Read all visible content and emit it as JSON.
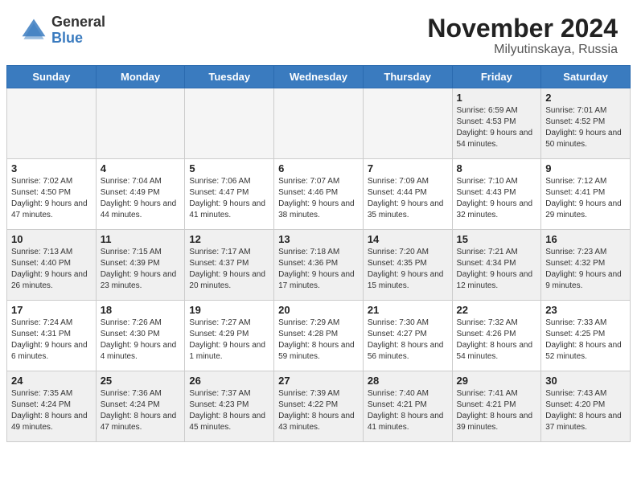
{
  "header": {
    "logo_general": "General",
    "logo_blue": "Blue",
    "title": "November 2024",
    "location": "Milyutinskaya, Russia"
  },
  "days_of_week": [
    "Sunday",
    "Monday",
    "Tuesday",
    "Wednesday",
    "Thursday",
    "Friday",
    "Saturday"
  ],
  "weeks": [
    [
      {
        "day": "",
        "empty": true
      },
      {
        "day": "",
        "empty": true
      },
      {
        "day": "",
        "empty": true
      },
      {
        "day": "",
        "empty": true
      },
      {
        "day": "",
        "empty": true
      },
      {
        "day": "1",
        "sunrise": "Sunrise: 6:59 AM",
        "sunset": "Sunset: 4:53 PM",
        "daylight": "Daylight: 9 hours and 54 minutes."
      },
      {
        "day": "2",
        "sunrise": "Sunrise: 7:01 AM",
        "sunset": "Sunset: 4:52 PM",
        "daylight": "Daylight: 9 hours and 50 minutes."
      }
    ],
    [
      {
        "day": "3",
        "sunrise": "Sunrise: 7:02 AM",
        "sunset": "Sunset: 4:50 PM",
        "daylight": "Daylight: 9 hours and 47 minutes."
      },
      {
        "day": "4",
        "sunrise": "Sunrise: 7:04 AM",
        "sunset": "Sunset: 4:49 PM",
        "daylight": "Daylight: 9 hours and 44 minutes."
      },
      {
        "day": "5",
        "sunrise": "Sunrise: 7:06 AM",
        "sunset": "Sunset: 4:47 PM",
        "daylight": "Daylight: 9 hours and 41 minutes."
      },
      {
        "day": "6",
        "sunrise": "Sunrise: 7:07 AM",
        "sunset": "Sunset: 4:46 PM",
        "daylight": "Daylight: 9 hours and 38 minutes."
      },
      {
        "day": "7",
        "sunrise": "Sunrise: 7:09 AM",
        "sunset": "Sunset: 4:44 PM",
        "daylight": "Daylight: 9 hours and 35 minutes."
      },
      {
        "day": "8",
        "sunrise": "Sunrise: 7:10 AM",
        "sunset": "Sunset: 4:43 PM",
        "daylight": "Daylight: 9 hours and 32 minutes."
      },
      {
        "day": "9",
        "sunrise": "Sunrise: 7:12 AM",
        "sunset": "Sunset: 4:41 PM",
        "daylight": "Daylight: 9 hours and 29 minutes."
      }
    ],
    [
      {
        "day": "10",
        "sunrise": "Sunrise: 7:13 AM",
        "sunset": "Sunset: 4:40 PM",
        "daylight": "Daylight: 9 hours and 26 minutes."
      },
      {
        "day": "11",
        "sunrise": "Sunrise: 7:15 AM",
        "sunset": "Sunset: 4:39 PM",
        "daylight": "Daylight: 9 hours and 23 minutes."
      },
      {
        "day": "12",
        "sunrise": "Sunrise: 7:17 AM",
        "sunset": "Sunset: 4:37 PM",
        "daylight": "Daylight: 9 hours and 20 minutes."
      },
      {
        "day": "13",
        "sunrise": "Sunrise: 7:18 AM",
        "sunset": "Sunset: 4:36 PM",
        "daylight": "Daylight: 9 hours and 17 minutes."
      },
      {
        "day": "14",
        "sunrise": "Sunrise: 7:20 AM",
        "sunset": "Sunset: 4:35 PM",
        "daylight": "Daylight: 9 hours and 15 minutes."
      },
      {
        "day": "15",
        "sunrise": "Sunrise: 7:21 AM",
        "sunset": "Sunset: 4:34 PM",
        "daylight": "Daylight: 9 hours and 12 minutes."
      },
      {
        "day": "16",
        "sunrise": "Sunrise: 7:23 AM",
        "sunset": "Sunset: 4:32 PM",
        "daylight": "Daylight: 9 hours and 9 minutes."
      }
    ],
    [
      {
        "day": "17",
        "sunrise": "Sunrise: 7:24 AM",
        "sunset": "Sunset: 4:31 PM",
        "daylight": "Daylight: 9 hours and 6 minutes."
      },
      {
        "day": "18",
        "sunrise": "Sunrise: 7:26 AM",
        "sunset": "Sunset: 4:30 PM",
        "daylight": "Daylight: 9 hours and 4 minutes."
      },
      {
        "day": "19",
        "sunrise": "Sunrise: 7:27 AM",
        "sunset": "Sunset: 4:29 PM",
        "daylight": "Daylight: 9 hours and 1 minute."
      },
      {
        "day": "20",
        "sunrise": "Sunrise: 7:29 AM",
        "sunset": "Sunset: 4:28 PM",
        "daylight": "Daylight: 8 hours and 59 minutes."
      },
      {
        "day": "21",
        "sunrise": "Sunrise: 7:30 AM",
        "sunset": "Sunset: 4:27 PM",
        "daylight": "Daylight: 8 hours and 56 minutes."
      },
      {
        "day": "22",
        "sunrise": "Sunrise: 7:32 AM",
        "sunset": "Sunset: 4:26 PM",
        "daylight": "Daylight: 8 hours and 54 minutes."
      },
      {
        "day": "23",
        "sunrise": "Sunrise: 7:33 AM",
        "sunset": "Sunset: 4:25 PM",
        "daylight": "Daylight: 8 hours and 52 minutes."
      }
    ],
    [
      {
        "day": "24",
        "sunrise": "Sunrise: 7:35 AM",
        "sunset": "Sunset: 4:24 PM",
        "daylight": "Daylight: 8 hours and 49 minutes."
      },
      {
        "day": "25",
        "sunrise": "Sunrise: 7:36 AM",
        "sunset": "Sunset: 4:24 PM",
        "daylight": "Daylight: 8 hours and 47 minutes."
      },
      {
        "day": "26",
        "sunrise": "Sunrise: 7:37 AM",
        "sunset": "Sunset: 4:23 PM",
        "daylight": "Daylight: 8 hours and 45 minutes."
      },
      {
        "day": "27",
        "sunrise": "Sunrise: 7:39 AM",
        "sunset": "Sunset: 4:22 PM",
        "daylight": "Daylight: 8 hours and 43 minutes."
      },
      {
        "day": "28",
        "sunrise": "Sunrise: 7:40 AM",
        "sunset": "Sunset: 4:21 PM",
        "daylight": "Daylight: 8 hours and 41 minutes."
      },
      {
        "day": "29",
        "sunrise": "Sunrise: 7:41 AM",
        "sunset": "Sunset: 4:21 PM",
        "daylight": "Daylight: 8 hours and 39 minutes."
      },
      {
        "day": "30",
        "sunrise": "Sunrise: 7:43 AM",
        "sunset": "Sunset: 4:20 PM",
        "daylight": "Daylight: 8 hours and 37 minutes."
      }
    ]
  ]
}
